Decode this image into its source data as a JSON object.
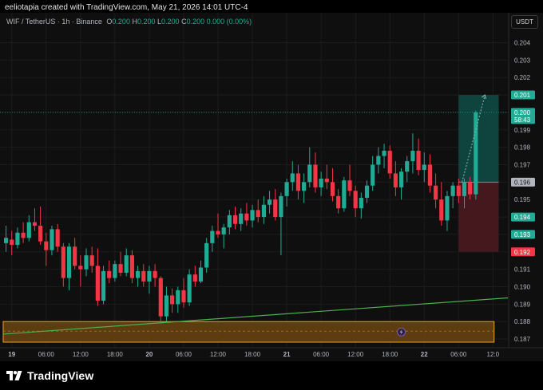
{
  "header": {
    "credit": "eeliotapia created with TradingView.com, May 21, 2026 14:01 UTC-4"
  },
  "legend": {
    "symbol": "WIF / TetherUS · 1h · Binance",
    "o_label": "O",
    "o_value": "0.200",
    "h_label": "H",
    "h_value": "0.200",
    "l_label": "L",
    "l_value": "0.200",
    "c_label": "C",
    "c_value": "0.200",
    "change": "0.000 (0.00%)"
  },
  "currency_button": "USDT",
  "footer": {
    "brand": "TradingView"
  },
  "colors": {
    "up": "#22ab94",
    "down": "#f23645",
    "trendline": "#4caf50",
    "zone_border": "#f0a020",
    "zone_fill": "#6b4410",
    "profit_zone": "#0e4a42",
    "loss_zone": "#4a1a1f"
  },
  "chart_data": {
    "type": "candlestick",
    "y_range": [
      0.1865,
      0.2048
    ],
    "y_ticks": [
      "0.204",
      "0.203",
      "0.202",
      "0.201",
      "0.200",
      "0.199",
      "0.198",
      "0.197",
      "0.196",
      "0.195",
      "0.194",
      "0.193",
      "0.192",
      "0.191",
      "0.190",
      "0.189",
      "0.188",
      "0.187"
    ],
    "x_ticks": [
      {
        "label": "19",
        "bold": true,
        "hour": 0
      },
      {
        "label": "06:00",
        "bold": false,
        "hour": 6
      },
      {
        "label": "12:00",
        "bold": false,
        "hour": 12
      },
      {
        "label": "18:00",
        "bold": false,
        "hour": 18
      },
      {
        "label": "20",
        "bold": true,
        "hour": 24
      },
      {
        "label": "06:00",
        "bold": false,
        "hour": 30
      },
      {
        "label": "12:00",
        "bold": false,
        "hour": 36
      },
      {
        "label": "18:00",
        "bold": false,
        "hour": 42
      },
      {
        "label": "21",
        "bold": true,
        "hour": 48
      },
      {
        "label": "06:00",
        "bold": false,
        "hour": 54
      },
      {
        "label": "12:00",
        "bold": false,
        "hour": 60
      },
      {
        "label": "18:00",
        "bold": false,
        "hour": 66
      },
      {
        "label": "22",
        "bold": true,
        "hour": 72
      },
      {
        "label": "06:00",
        "bold": false,
        "hour": 78
      },
      {
        "label": "12:0",
        "bold": false,
        "hour": 84
      }
    ],
    "x_range_hours": [
      -1.5,
      86.6
    ],
    "candles": [
      [
        -1,
        0.1925,
        0.1935,
        0.192,
        0.1928
      ],
      [
        0,
        0.1927,
        0.1932,
        0.1918,
        0.1924
      ],
      [
        1,
        0.1924,
        0.1934,
        0.1922,
        0.1931
      ],
      [
        2,
        0.1931,
        0.1937,
        0.1925,
        0.1928
      ],
      [
        3,
        0.1928,
        0.1941,
        0.1926,
        0.1937
      ],
      [
        4,
        0.1937,
        0.1945,
        0.1932,
        0.1935
      ],
      [
        5,
        0.1935,
        0.1946,
        0.1924,
        0.1926
      ],
      [
        6,
        0.1926,
        0.1931,
        0.1912,
        0.1921
      ],
      [
        7,
        0.1921,
        0.1935,
        0.1918,
        0.1933
      ],
      [
        8,
        0.1933,
        0.1936,
        0.192,
        0.1923
      ],
      [
        9,
        0.1923,
        0.1925,
        0.19,
        0.1905
      ],
      [
        10,
        0.1905,
        0.1925,
        0.1898,
        0.1923
      ],
      [
        11,
        0.1923,
        0.1928,
        0.191,
        0.1912
      ],
      [
        12,
        0.1912,
        0.1918,
        0.19,
        0.191
      ],
      [
        13,
        0.191,
        0.1922,
        0.1906,
        0.1918
      ],
      [
        14,
        0.1918,
        0.1923,
        0.1908,
        0.1912
      ],
      [
        15,
        0.1912,
        0.1922,
        0.1889,
        0.1892
      ],
      [
        16,
        0.1892,
        0.1912,
        0.189,
        0.1909
      ],
      [
        17,
        0.1909,
        0.1915,
        0.1902,
        0.1905
      ],
      [
        18,
        0.1905,
        0.1915,
        0.1903,
        0.1913
      ],
      [
        19,
        0.1913,
        0.192,
        0.1906,
        0.1908
      ],
      [
        20,
        0.1908,
        0.1922,
        0.1906,
        0.1918
      ],
      [
        21,
        0.1918,
        0.1921,
        0.1902,
        0.1905
      ],
      [
        22,
        0.1905,
        0.1912,
        0.19,
        0.1909
      ],
      [
        23,
        0.1909,
        0.1913,
        0.19,
        0.1903
      ],
      [
        24,
        0.1903,
        0.1912,
        0.1896,
        0.1909
      ],
      [
        25,
        0.1909,
        0.1913,
        0.19,
        0.1905
      ],
      [
        26,
        0.1905,
        0.1906,
        0.188,
        0.1883
      ],
      [
        27,
        0.1883,
        0.19,
        0.188,
        0.1895
      ],
      [
        28,
        0.1895,
        0.1899,
        0.1885,
        0.189
      ],
      [
        29,
        0.189,
        0.19,
        0.1885,
        0.1898
      ],
      [
        30,
        0.1898,
        0.1905,
        0.1888,
        0.1891
      ],
      [
        31,
        0.1891,
        0.191,
        0.1889,
        0.1907
      ],
      [
        32,
        0.1907,
        0.1912,
        0.19,
        0.1903
      ],
      [
        33,
        0.1903,
        0.1915,
        0.1902,
        0.1911
      ],
      [
        34,
        0.1911,
        0.1928,
        0.1908,
        0.1925
      ],
      [
        35,
        0.1925,
        0.1935,
        0.192,
        0.1932
      ],
      [
        36,
        0.1932,
        0.1942,
        0.1928,
        0.193
      ],
      [
        37,
        0.193,
        0.1936,
        0.1922,
        0.1934
      ],
      [
        38,
        0.1934,
        0.1944,
        0.193,
        0.1941
      ],
      [
        39,
        0.1941,
        0.1946,
        0.1933,
        0.1936
      ],
      [
        40,
        0.1936,
        0.1945,
        0.1932,
        0.1942
      ],
      [
        41,
        0.1942,
        0.1948,
        0.1935,
        0.1938
      ],
      [
        42,
        0.1938,
        0.1947,
        0.1934,
        0.1944
      ],
      [
        43,
        0.1944,
        0.195,
        0.1937,
        0.194
      ],
      [
        44,
        0.194,
        0.1952,
        0.1936,
        0.1947
      ],
      [
        45,
        0.1947,
        0.1955,
        0.1942,
        0.195
      ],
      [
        46,
        0.195,
        0.1956,
        0.1938,
        0.194
      ],
      [
        47,
        0.194,
        0.1954,
        0.1918,
        0.1952
      ],
      [
        48,
        0.1952,
        0.1962,
        0.1946,
        0.196
      ],
      [
        49,
        0.196,
        0.1972,
        0.1955,
        0.1965
      ],
      [
        50,
        0.1965,
        0.197,
        0.195,
        0.1955
      ],
      [
        51,
        0.1955,
        0.1965,
        0.1948,
        0.196
      ],
      [
        52,
        0.196,
        0.198,
        0.1957,
        0.197
      ],
      [
        53,
        0.197,
        0.1977,
        0.1954,
        0.1957
      ],
      [
        54,
        0.1957,
        0.1966,
        0.1952,
        0.1962
      ],
      [
        55,
        0.1962,
        0.197,
        0.1956,
        0.196
      ],
      [
        56,
        0.196,
        0.1968,
        0.1949,
        0.1952
      ],
      [
        57,
        0.1952,
        0.1956,
        0.1942,
        0.1945
      ],
      [
        58,
        0.1945,
        0.1963,
        0.1943,
        0.1961
      ],
      [
        59,
        0.1961,
        0.197,
        0.1952,
        0.1955
      ],
      [
        60,
        0.1955,
        0.1958,
        0.194,
        0.1945
      ],
      [
        61,
        0.1945,
        0.1954,
        0.1939,
        0.1951
      ],
      [
        62,
        0.1951,
        0.1961,
        0.1948,
        0.1958
      ],
      [
        63,
        0.1958,
        0.1975,
        0.1955,
        0.197
      ],
      [
        64,
        0.197,
        0.198,
        0.1965,
        0.1975
      ],
      [
        65,
        0.1975,
        0.1982,
        0.1968,
        0.1978
      ],
      [
        66,
        0.1978,
        0.1981,
        0.1962,
        0.1965
      ],
      [
        67,
        0.1965,
        0.1972,
        0.1952,
        0.1957
      ],
      [
        68,
        0.1957,
        0.1968,
        0.195,
        0.1966
      ],
      [
        69,
        0.1966,
        0.1975,
        0.196,
        0.1972
      ],
      [
        70,
        0.1972,
        0.1988,
        0.1965,
        0.1978
      ],
      [
        71,
        0.1978,
        0.1985,
        0.1964,
        0.1967
      ],
      [
        72,
        0.1967,
        0.1977,
        0.196,
        0.197
      ],
      [
        73,
        0.197,
        0.1976,
        0.1954,
        0.1958
      ],
      [
        74,
        0.1958,
        0.1965,
        0.1945,
        0.195
      ],
      [
        75,
        0.195,
        0.196,
        0.1935,
        0.1938
      ],
      [
        76,
        0.1938,
        0.1955,
        0.1932,
        0.1952
      ],
      [
        77,
        0.1952,
        0.196,
        0.1945,
        0.1958
      ],
      [
        78,
        0.1958,
        0.1962,
        0.1948,
        0.1952
      ],
      [
        79,
        0.1952,
        0.1962,
        0.1945,
        0.196
      ],
      [
        80,
        0.196,
        0.1963,
        0.195,
        0.1953
      ],
      [
        81,
        0.1953,
        0.2001,
        0.195,
        0.2
      ]
    ],
    "position": {
      "start_hour": 78.0,
      "end_hour": 85.0,
      "entry": 0.196,
      "take_profit": 0.201,
      "stop_loss": 0.192
    },
    "trendline": {
      "from": [
        -1.5,
        0.18728
      ],
      "to": [
        86.6,
        0.18936
      ]
    },
    "support_zone": {
      "from_hour": -1.5,
      "to_hour": 84.2,
      "low": 0.18682,
      "high": 0.188,
      "mid": 0.18745
    },
    "marker_hour": 68.0,
    "price_labels": [
      {
        "value": 0.201,
        "text": "0.201",
        "kind": "up"
      },
      {
        "value": 0.2,
        "text": "0.200",
        "sub": "58:43",
        "kind": "up"
      },
      {
        "value": 0.196,
        "text": "0.196",
        "kind": "grey"
      },
      {
        "value": 0.194,
        "text": "0.194",
        "kind": "up"
      },
      {
        "value": 0.193,
        "text": "0.193",
        "kind": "up"
      },
      {
        "value": 0.192,
        "text": "0.192",
        "kind": "down"
      }
    ]
  }
}
